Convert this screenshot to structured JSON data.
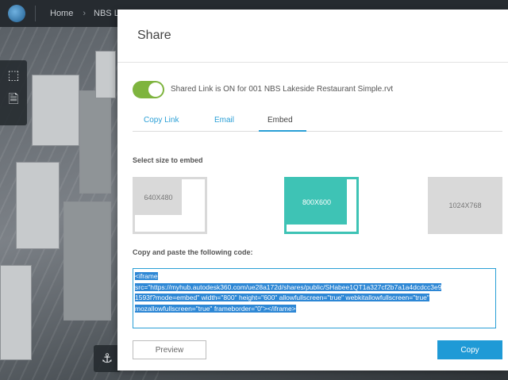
{
  "topbar": {
    "home_label": "Home",
    "separator": "›",
    "breadcrumb_current": "NBS Lak"
  },
  "viewer": {
    "tools": [
      {
        "icon": "cube-icon",
        "glyph": "⬚"
      },
      {
        "icon": "document-icon",
        "glyph": "🗎"
      }
    ],
    "bottom_tool_glyph": "⚓"
  },
  "dialog": {
    "title": "Share",
    "shared_link_text": "Shared Link is ON for 001 NBS Lakeside Restaurant Simple.rvt",
    "shared_link_on": true,
    "tabs": [
      {
        "label": "Copy Link",
        "active": false
      },
      {
        "label": "Email",
        "active": false
      },
      {
        "label": "Embed",
        "active": true
      }
    ],
    "select_size_label": "Select size to embed",
    "sizes": [
      {
        "label": "640X480",
        "selected": false
      },
      {
        "label": "800X600",
        "selected": true
      },
      {
        "label": "1024X768",
        "selected": false
      }
    ],
    "code_label": "Copy and paste the following code:",
    "code_lines": [
      "<iframe",
      "src=\"https://myhub.autodesk360.com/ue28a172d/shares/public/SHabee1QT1a327cf2b7a1a4dcdcc3e9",
      "1593f?mode=embed\" width=\"800\" height=\"600\" allowfullscreen=\"true\" webkitallowfullscreen=\"true\"",
      "mozallowfullscreen=\"true\"  frameborder=\"0\"></iframe>"
    ],
    "preview_label": "Preview",
    "copy_label": "Copy"
  },
  "colors": {
    "accent": "#2a9fd6",
    "selected": "#3ec3b5",
    "toggle_on": "#7eb43e"
  }
}
